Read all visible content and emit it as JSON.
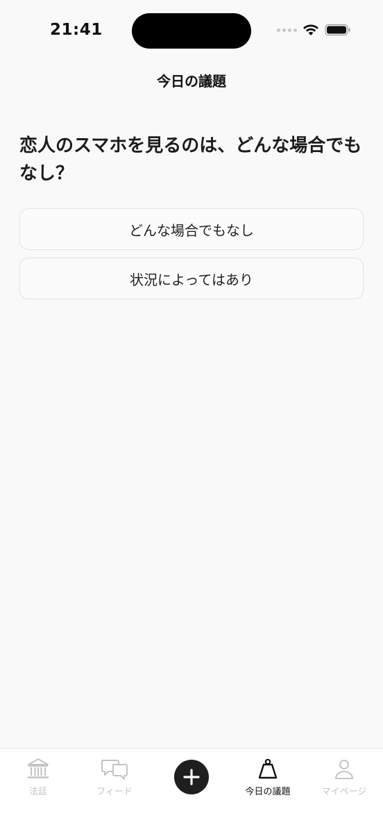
{
  "status_bar": {
    "time": "21:41"
  },
  "header": {
    "title": "今日の議題"
  },
  "topic": {
    "question": "恋人のスマホを見るのは、どんな場合でもなし？",
    "options": [
      "どんな場合でもなし",
      "状況によってはあり"
    ]
  },
  "tab_bar": {
    "items": [
      {
        "label": "法廷",
        "icon": "courthouse-icon"
      },
      {
        "label": "フィード",
        "icon": "chat-bubbles-icon"
      },
      {
        "label": "",
        "icon": "plus-icon"
      },
      {
        "label": "今日の議題",
        "icon": "scale-weight-icon",
        "active": true
      },
      {
        "label": "マイページ",
        "icon": "person-icon"
      }
    ]
  },
  "colors": {
    "background": "#f9f9f9",
    "active_tab": "#111111",
    "inactive_tab": "#c4c4c4",
    "add_button": "#1f1f1f"
  }
}
